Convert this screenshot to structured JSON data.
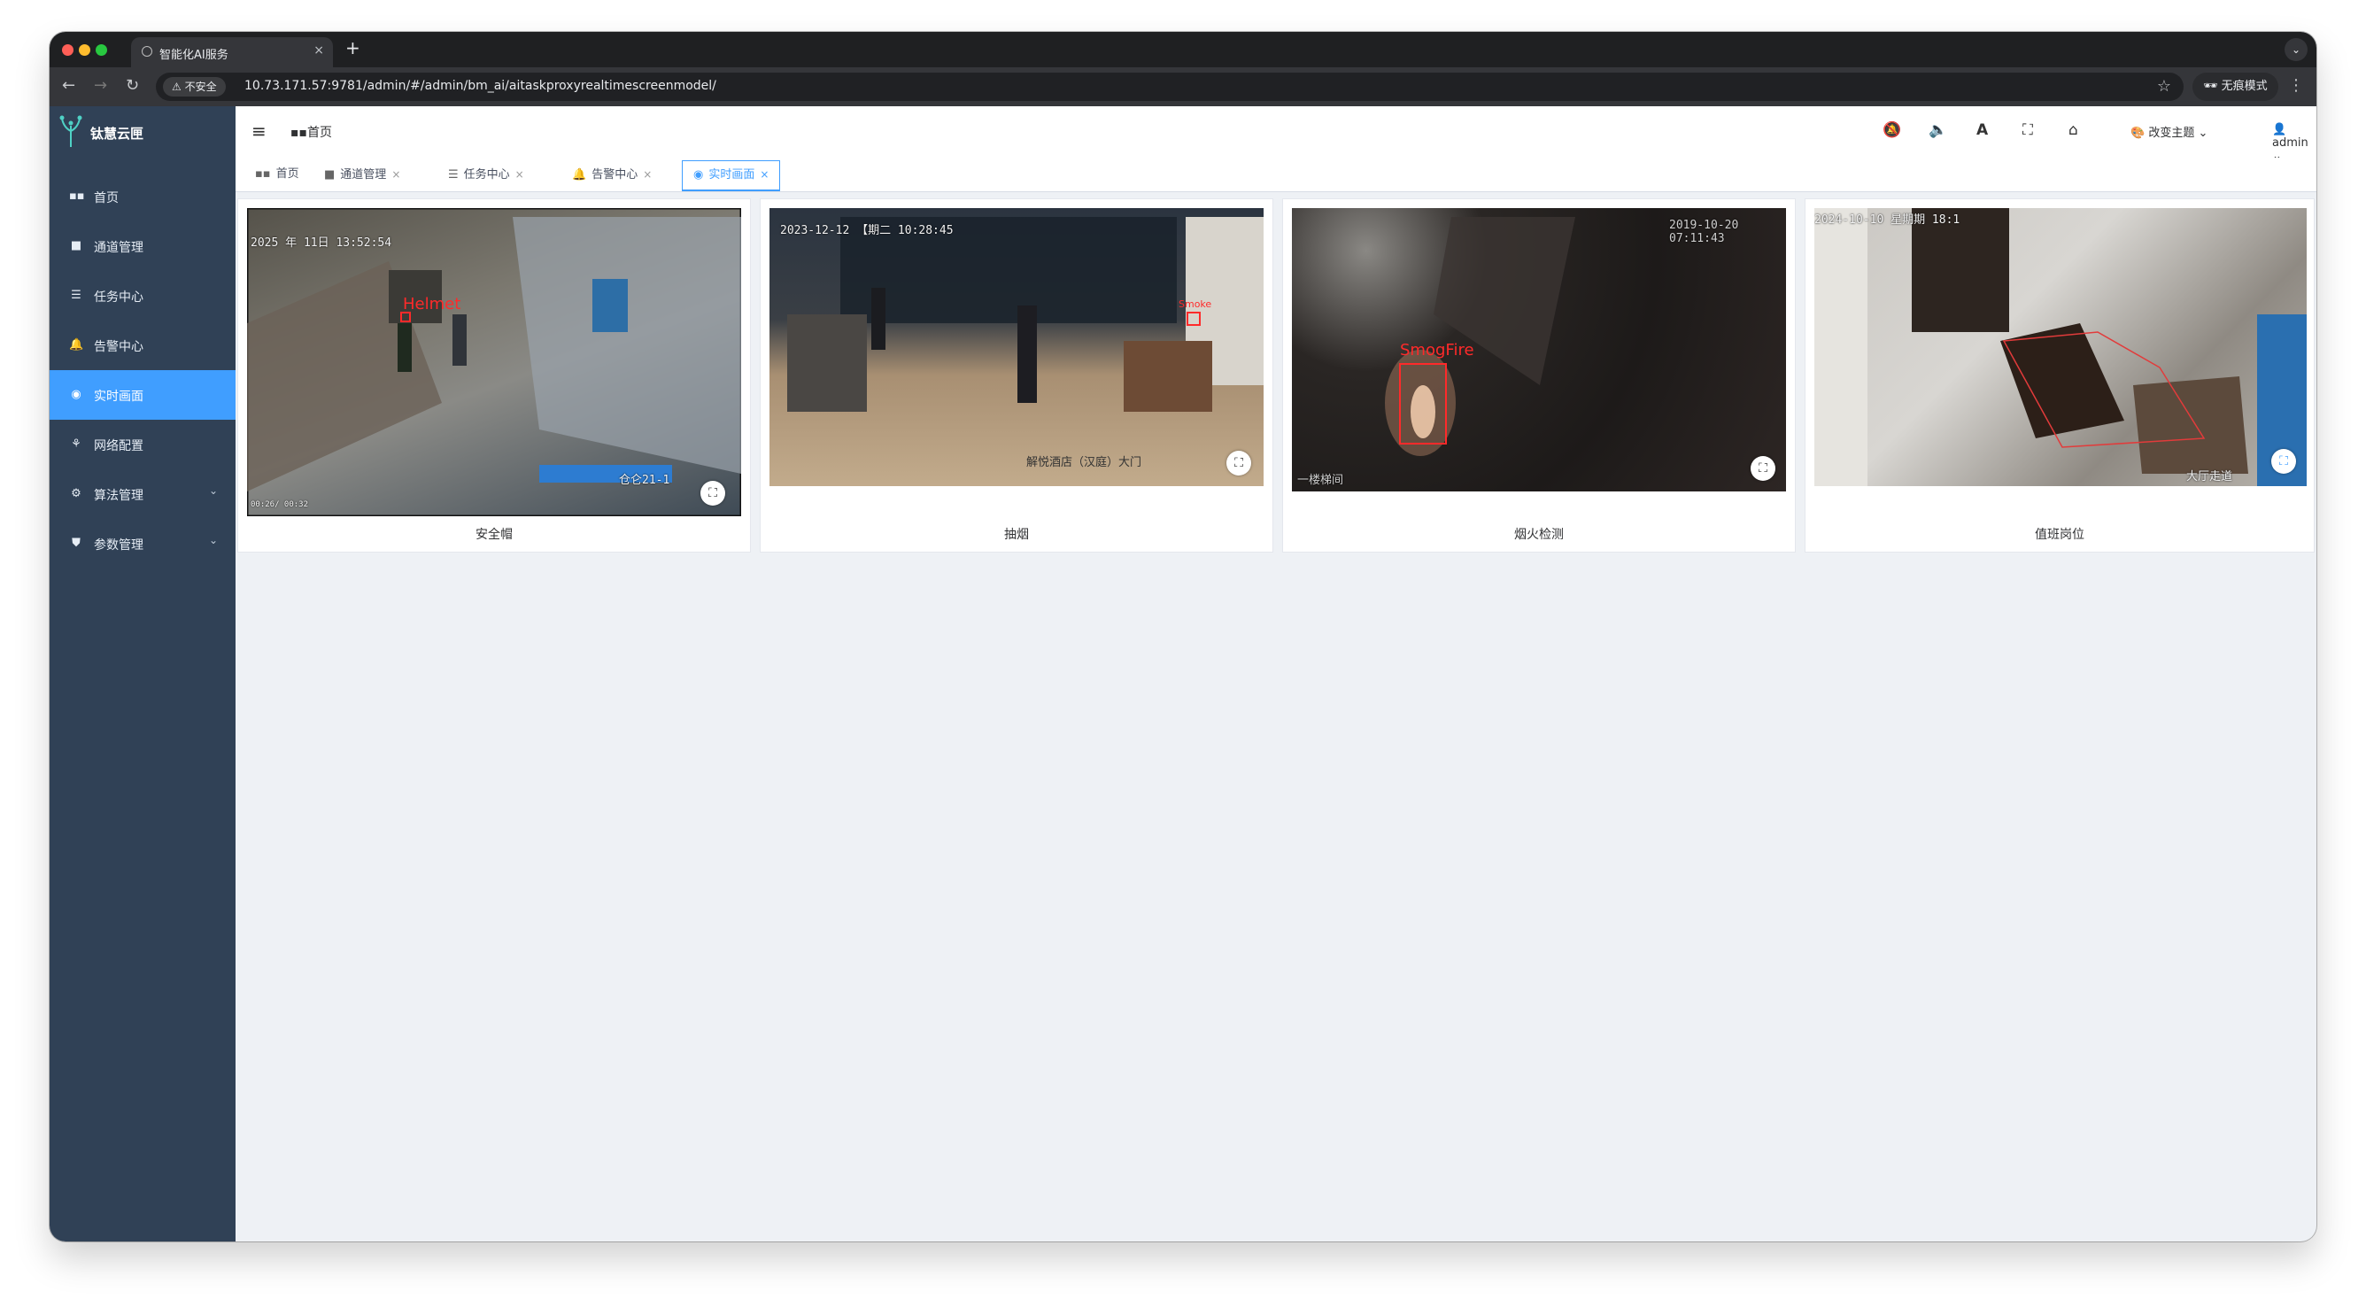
{
  "browser": {
    "tab_title": "智能化AI服务",
    "tab_close": "×",
    "new_tab": "+",
    "security_label": "不安全",
    "url": "10.73.171.57:9781/admin/#/admin/bm_ai/aitaskproxyrealtimescreenmodel/",
    "incognito_label": "无痕模式"
  },
  "app": {
    "logo_text": "钛慧云匣"
  },
  "sidebar": {
    "items": [
      {
        "label": "首页",
        "icon": "dashboard-icon"
      },
      {
        "label": "通道管理",
        "icon": "video-camera-icon"
      },
      {
        "label": "任务中心",
        "icon": "server-icon"
      },
      {
        "label": "告警中心",
        "icon": "bell-icon"
      },
      {
        "label": "实时画面",
        "icon": "eye-icon",
        "active": true
      },
      {
        "label": "网络配置",
        "icon": "network-icon"
      },
      {
        "label": "算法管理",
        "icon": "algorithm-icon",
        "expandable": true
      },
      {
        "label": "参数管理",
        "icon": "shield-icon",
        "expandable": true
      }
    ]
  },
  "header": {
    "breadcrumb": "首页",
    "theme_label": "改变主题",
    "user_label": "admin"
  },
  "tags": [
    {
      "label": "首页",
      "closable": false
    },
    {
      "label": "通道管理",
      "closable": true
    },
    {
      "label": "任务中心",
      "closable": true
    },
    {
      "label": "告警中心",
      "closable": true
    },
    {
      "label": "实时画面",
      "closable": true,
      "active": true
    }
  ],
  "tag_close": "×",
  "cards": [
    {
      "label": "安全帽",
      "timestamp": "2025 年 11日 13:52:54",
      "detection": "Helmet",
      "overlay": "仓仑21-1",
      "player_time": "00:26/ 00:32"
    },
    {
      "label": "抽烟",
      "timestamp": "2023-12-12 【期二 10:28:45",
      "detection": "Smoke",
      "overlay": "解悦酒店（汉庭）大门"
    },
    {
      "label": "烟火检测",
      "timestamp": "2019-10-20 07:11:43",
      "detection": "SmogFire",
      "overlay": "一楼梯间"
    },
    {
      "label": "值班岗位",
      "timestamp": "2024-10-10 星期期 18:1",
      "overlay": "大厅走道"
    }
  ],
  "colors": {
    "sidebar_bg": "#304156",
    "accent": "#409eff",
    "detection": "#ff2a2a"
  }
}
